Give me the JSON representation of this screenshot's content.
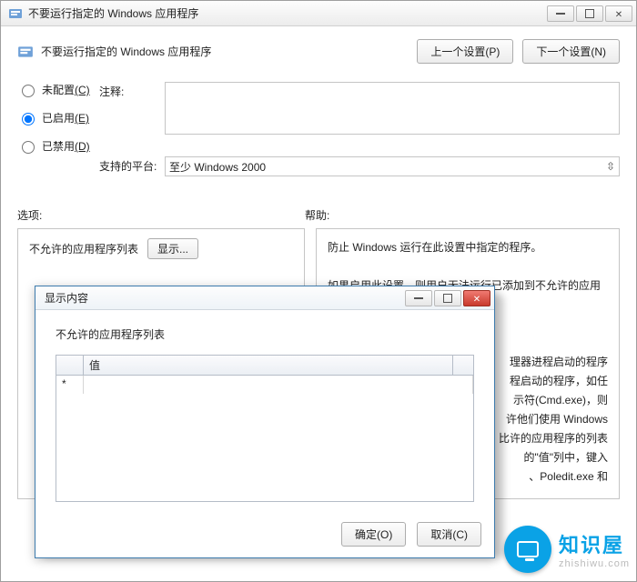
{
  "window": {
    "title": "不要运行指定的 Windows 应用程序",
    "controls": {
      "min": "_",
      "max": "□",
      "close": "✕"
    }
  },
  "header": {
    "title": "不要运行指定的 Windows 应用程序",
    "prev": "上一个设置(P)",
    "next": "下一个设置(N)"
  },
  "radios": {
    "notconf": {
      "label": "未配置",
      "hot": "(C)"
    },
    "enabled": {
      "label": "已启用",
      "hot": "(E)"
    },
    "disabled": {
      "label": "已禁用",
      "hot": "(D)"
    },
    "selected": "enabled"
  },
  "fields": {
    "comment_label": "注释:",
    "comment_value": "",
    "platform_label": "支持的平台:",
    "platform_value": "至少 Windows 2000"
  },
  "sections": {
    "options": "选项:",
    "help": "帮助:"
  },
  "options": {
    "listlabel": "不允许的应用程序列表",
    "showbtn": "显示..."
  },
  "help": {
    "p1": "防止 Windows 运行在此设置中指定的程序。",
    "p2": "如果启用此设置，则用户无法运行已添加到不允许的应用程序列",
    "p3": "理器进程启动的程序",
    "p4": "程启动的程序，如任",
    "p5": "示符(Cmd.exe)，则",
    "p6": "许他们使用 Windows",
    "p7": "比许的应用程序的列表",
    "p8": "的\"值\"列中，键入",
    "p9": "、Poledit.exe 和"
  },
  "modal": {
    "title": "显示内容",
    "subtitle": "不允许的应用程序列表",
    "col0": "",
    "col1": "值",
    "newrow_marker": "*",
    "ok": "确定(O)",
    "cancel": "取消(C)"
  },
  "watermark": {
    "text1": "知识屋",
    "text2": "zhishiwu.com"
  }
}
